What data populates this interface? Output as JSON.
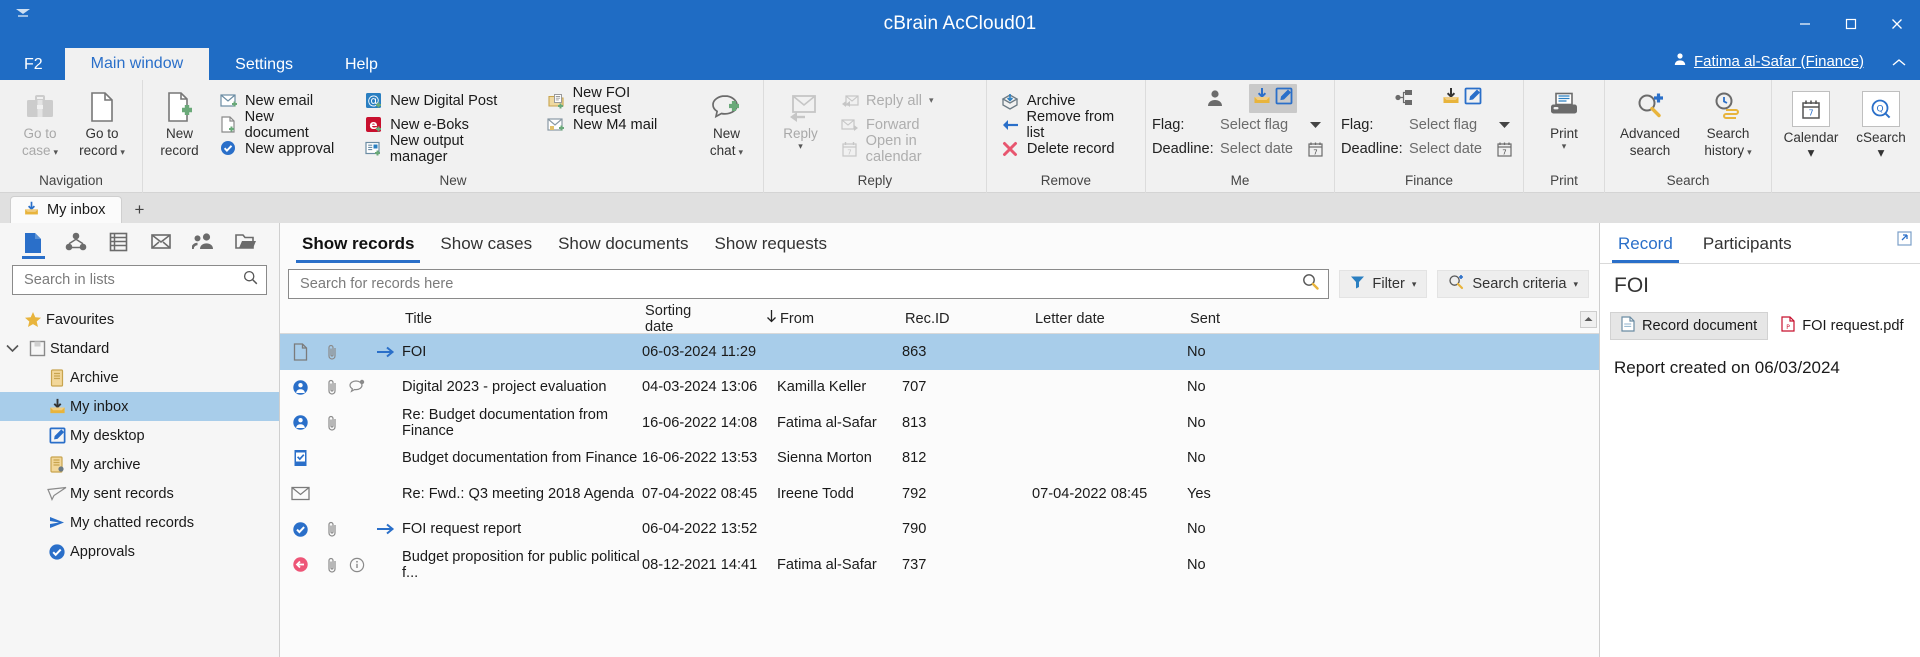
{
  "window": {
    "title": "cBrain AcCloud01",
    "quick_access_icon": "customize-quick-access-icon",
    "minimize": "minimize-icon",
    "maximize": "maximize-icon",
    "close": "close-icon"
  },
  "menubar": {
    "items": [
      {
        "label": "F2",
        "active": false
      },
      {
        "label": "Main window",
        "active": true
      },
      {
        "label": "Settings",
        "active": false
      },
      {
        "label": "Help",
        "active": false
      }
    ],
    "user": "Fatima al-Safar (Finance)"
  },
  "ribbon": {
    "groups": [
      {
        "name": "Navigation",
        "label": "Navigation",
        "big_buttons": [
          {
            "label_line1": "Go to",
            "label_line2": "case",
            "icon": "briefcase-icon",
            "caret": true,
            "dim": true
          },
          {
            "label_line1": "Go to",
            "label_line2": "record",
            "icon": "document-icon",
            "caret": true,
            "dim": false
          }
        ]
      },
      {
        "name": "New",
        "label": "New",
        "big_buttons": [
          {
            "label_line1": "New",
            "label_line2": "record",
            "icon": "new-record-icon",
            "caret": false,
            "dim": false
          }
        ],
        "columns": [
          [
            {
              "label": "New email",
              "icon": "new-email-icon"
            },
            {
              "label": "New document",
              "icon": "new-document-icon"
            },
            {
              "label": "New approval",
              "icon": "new-approval-icon"
            }
          ],
          [
            {
              "label": "New Digital Post",
              "icon": "digital-post-icon"
            },
            {
              "label": "New e-Boks",
              "icon": "eboks-icon"
            },
            {
              "label": "New output manager",
              "icon": "output-manager-icon"
            }
          ],
          [
            {
              "label": "New FOI request",
              "icon": "foi-request-icon"
            },
            {
              "label": "New M4 mail",
              "icon": "m4-mail-icon"
            }
          ]
        ],
        "trailing_big": {
          "label_line1": "New",
          "label_line2": "chat",
          "icon": "new-chat-icon",
          "caret": true
        }
      },
      {
        "name": "Reply",
        "label": "Reply",
        "big_buttons": [
          {
            "label_line1": "Reply",
            "label_line2": "",
            "icon": "reply-icon",
            "caret": true,
            "dim": true
          }
        ],
        "columns": [
          [
            {
              "label": "Reply all",
              "icon": "reply-all-icon",
              "caret": true,
              "dim": true
            },
            {
              "label": "Forward",
              "icon": "forward-icon",
              "dim": true
            },
            {
              "label": "Open in calendar",
              "icon": "calendar-small-icon",
              "dim": true
            }
          ]
        ]
      },
      {
        "name": "Remove",
        "label": "Remove",
        "columns": [
          [
            {
              "label": "Archive",
              "icon": "archive-icon"
            },
            {
              "label": "Remove from list",
              "icon": "remove-from-list-icon"
            },
            {
              "label": "Delete record",
              "icon": "delete-record-icon"
            }
          ]
        ]
      },
      {
        "name": "Me",
        "label": "Me",
        "person_icon": "person-icon",
        "toolbar_icons": [
          "inbox-icon",
          "desktop-icon"
        ],
        "flag_label": "Flag:",
        "flag_value": "Select flag",
        "deadline_label": "Deadline:",
        "deadline_value": "Select date",
        "flag_caret": "chevron-down-icon",
        "date_picker": "calendar-picker-icon"
      },
      {
        "name": "Finance",
        "label": "Finance",
        "person_icon": "org-unit-icon",
        "toolbar_icons": [
          "inbox-icon",
          "desktop-icon"
        ],
        "flag_label": "Flag:",
        "flag_value": "Select flag",
        "deadline_label": "Deadline:",
        "deadline_value": "Select date",
        "flag_caret": "chevron-down-icon",
        "date_picker": "calendar-picker-icon"
      },
      {
        "name": "Print",
        "label": "Print",
        "big_buttons": [
          {
            "label_line1": "Print",
            "label_line2": "",
            "icon": "printer-icon",
            "caret": true,
            "dim": false
          }
        ]
      },
      {
        "name": "Search",
        "label": "Search",
        "big_buttons": [
          {
            "label_line1": "Advanced",
            "label_line2": "search",
            "icon": "advanced-search-icon",
            "caret": false,
            "dim": false
          },
          {
            "label_line1": "Search",
            "label_line2": "history",
            "icon": "search-history-icon",
            "caret": true,
            "dim": false
          }
        ]
      },
      {
        "name": "Apps",
        "label": "",
        "card_buttons": [
          {
            "label": "Calendar",
            "icon": "calendar-icon",
            "caret": true
          },
          {
            "label": "cSearch",
            "icon": "csearch-icon",
            "caret": true
          }
        ]
      }
    ]
  },
  "tabstrip": {
    "tabs": [
      {
        "label": "My inbox",
        "icon": "inbox-icon",
        "active": true
      }
    ],
    "add_label": "+"
  },
  "sidebar": {
    "icon_row": [
      {
        "name": "records-icon",
        "selected": true
      },
      {
        "name": "cases-icon",
        "selected": false
      },
      {
        "name": "documents-icon",
        "selected": false
      },
      {
        "name": "mail-icon",
        "selected": false
      },
      {
        "name": "contacts-icon",
        "selected": false
      },
      {
        "name": "folders-icon",
        "selected": false
      }
    ],
    "search_placeholder": "Search in lists",
    "search_icon": "search-icon",
    "items": [
      {
        "label": "Favourites",
        "icon": "star-icon",
        "level": 1,
        "expander": "",
        "selected": false
      },
      {
        "label": "Standard",
        "icon": "standard-icon",
        "level": 0,
        "expander": "chevron-down-icon",
        "selected": false
      },
      {
        "label": "Archive",
        "icon": "archive-list-icon",
        "level": 2,
        "expander": "",
        "selected": false
      },
      {
        "label": "My inbox",
        "icon": "inbox-icon",
        "level": 2,
        "expander": "",
        "selected": true
      },
      {
        "label": "My desktop",
        "icon": "desktop-icon",
        "level": 2,
        "expander": "",
        "selected": false
      },
      {
        "label": "My archive",
        "icon": "my-archive-icon",
        "level": 2,
        "expander": "",
        "selected": false
      },
      {
        "label": "My sent records",
        "icon": "sent-icon",
        "level": 2,
        "expander": "",
        "selected": false
      },
      {
        "label": "My chatted records",
        "icon": "chat-arrow-icon",
        "level": 2,
        "expander": "",
        "selected": false
      },
      {
        "label": "Approvals",
        "icon": "approval-icon",
        "level": 2,
        "expander": "",
        "selected": false
      }
    ]
  },
  "results": {
    "tabs": [
      {
        "label": "Show records",
        "active": true
      },
      {
        "label": "Show cases",
        "active": false
      },
      {
        "label": "Show documents",
        "active": false
      },
      {
        "label": "Show requests",
        "active": false
      }
    ],
    "search_placeholder": "Search for records here",
    "search_value": "",
    "search_icon": "search-icon",
    "filter_label": "Filter",
    "filter_icon": "funnel-icon",
    "search_criteria_label": "Search criteria",
    "search_criteria_icon": "search-plus-icon",
    "columns": [
      {
        "key": "title",
        "label": "Title"
      },
      {
        "key": "sorting_date",
        "label": "Sorting date",
        "sort": "desc",
        "sort_icon": "arrow-down-icon"
      },
      {
        "key": "from",
        "label": "From"
      },
      {
        "key": "rec_id",
        "label": "Rec.ID"
      },
      {
        "key": "letter_date",
        "label": "Letter date"
      },
      {
        "key": "sent",
        "label": "Sent"
      }
    ],
    "rows": [
      {
        "icons": [
          "document-outline-icon",
          "paperclip-icon",
          "",
          "arrow-right-icon"
        ],
        "title": "FOI",
        "sorting_date": "06-03-2024 11:29",
        "from": "",
        "rec_id": "863",
        "letter_date": "",
        "sent": "No",
        "selected": true
      },
      {
        "icons": [
          "person-record-icon",
          "paperclip-icon",
          "chat-bubble-icon",
          ""
        ],
        "title": "Digital 2023 - project evaluation",
        "sorting_date": "04-03-2024 13:06",
        "from": "Kamilla Keller",
        "rec_id": "707",
        "letter_date": "",
        "sent": "No",
        "selected": false
      },
      {
        "icons": [
          "person-record-icon",
          "paperclip-icon",
          "",
          ""
        ],
        "title": "Re: Budget documentation from Finance",
        "sorting_date": "16-06-2022 14:08",
        "from": "Fatima al-Safar",
        "rec_id": "813",
        "letter_date": "",
        "sent": "No",
        "selected": false
      },
      {
        "icons": [
          "checkbox-record-icon",
          "",
          "",
          ""
        ],
        "title": "Budget documentation from Finance",
        "sorting_date": "16-06-2022 13:53",
        "from": "Sienna Morton",
        "rec_id": "812",
        "letter_date": "",
        "sent": "No",
        "selected": false
      },
      {
        "icons": [
          "envelope-icon",
          "",
          "",
          ""
        ],
        "title": "Re: Fwd.: Q3 meeting 2018 Agenda",
        "sorting_date": "07-04-2022 08:45",
        "from": "Ireene Todd",
        "rec_id": "792",
        "letter_date": "07-04-2022 08:45",
        "sent": "Yes",
        "selected": false
      },
      {
        "icons": [
          "approval-check-icon",
          "paperclip-icon",
          "",
          "arrow-right-icon"
        ],
        "title": "FOI request report",
        "sorting_date": "06-04-2022 13:52",
        "from": "",
        "rec_id": "790",
        "letter_date": "",
        "sent": "No",
        "selected": false
      },
      {
        "icons": [
          "return-red-icon",
          "paperclip-icon",
          "info-icon",
          ""
        ],
        "title": "Budget proposition for public political f...",
        "sorting_date": "08-12-2021 14:41",
        "from": "Fatima al-Safar",
        "rec_id": "737",
        "letter_date": "",
        "sent": "No",
        "selected": false
      }
    ]
  },
  "preview": {
    "tabs": [
      {
        "label": "Record",
        "active": true
      },
      {
        "label": "Participants",
        "active": false
      }
    ],
    "expand_icon": "expand-icon",
    "title": "FOI",
    "doc_tabs": [
      {
        "label": "Record document",
        "icon": "document-icon",
        "active": true
      },
      {
        "label": "FOI request.pdf",
        "icon": "pdf-icon",
        "active": false
      }
    ],
    "body_text": "Report created on 06/03/2024"
  },
  "colors": {
    "brand_blue": "#1f6cc4",
    "accent_blue": "#2a6fc9",
    "selection_blue": "#a8cdea",
    "ribbon_bg": "#f1f1f1",
    "sidebar_bg": "#f6f6f6",
    "flag_red": "#e8566f",
    "green": "#5aa469",
    "gold": "#e8b43c"
  }
}
